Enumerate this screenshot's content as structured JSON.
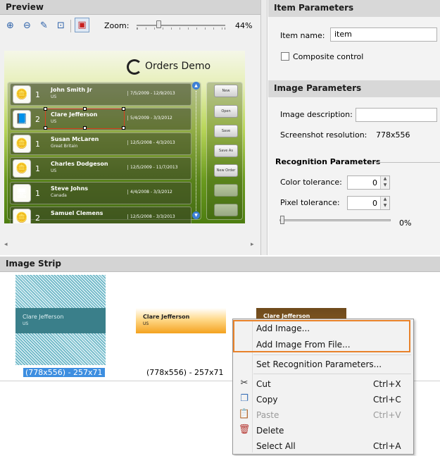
{
  "preview": {
    "title": "Preview",
    "zoom_label": "Zoom:",
    "zoom_value": "44%",
    "zoom_level": 0.44,
    "toolbar_icons": [
      "zoom-in-icon",
      "zoom-out-icon",
      "eyedropper-icon",
      "zoom-fit-icon",
      "select-region-icon"
    ]
  },
  "demo": {
    "title": "Orders Demo",
    "rows": [
      {
        "name": "John Smith Jr",
        "sub": "US",
        "count": "1",
        "dates": "7/5/2009 - 12/9/2013",
        "icon": "coins-icon"
      },
      {
        "name": "Clare Jefferson",
        "sub": "US",
        "count": "2",
        "dates": "5/4/2009 - 3/3/2012",
        "icon": "book-icon"
      },
      {
        "name": "Susan McLaren",
        "sub": "Great Britain",
        "count": "1",
        "dates": "12/5/2008 - 4/3/2013",
        "icon": "coins-icon"
      },
      {
        "name": "Charles Dodgeson",
        "sub": "US",
        "count": "1",
        "dates": "12/5/2009 - 11/7/2013",
        "icon": "coins-icon"
      },
      {
        "name": "Steve Johns",
        "sub": "Canada",
        "count": "1",
        "dates": "4/4/2008 - 3/3/2012",
        "icon": "computer-icon"
      },
      {
        "name": "Samuel Clemens",
        "sub": "",
        "count": "2",
        "dates": "12/5/2008 - 3/3/2013",
        "icon": "coins-icon"
      }
    ],
    "buttons": [
      "New",
      "Open",
      "Save",
      "Save As",
      "New Order",
      "",
      ""
    ]
  },
  "item_params": {
    "title": "Item Parameters",
    "name_label": "Item name:",
    "name_value": "item",
    "composite_label": "Composite control",
    "composite_checked": false
  },
  "image_params": {
    "title": "Image Parameters",
    "desc_label": "Image description:",
    "desc_value": "",
    "resolution_label": "Screenshot resolution:",
    "resolution_value": "778x556"
  },
  "recog_params": {
    "title": "Recognition Parameters",
    "color_label": "Color tolerance:",
    "color_value": "0",
    "pixel_label": "Pixel tolerance:",
    "pixel_value": "0",
    "slider_value": "0%"
  },
  "strip": {
    "title": "Image Strip",
    "items": [
      {
        "text": "Clare Jefferson",
        "sub": "US",
        "caption": "(778x556) - 257x71",
        "selected": true
      },
      {
        "text": "Clare Jefferson",
        "sub": "US",
        "caption": "(778x556) - 257x71",
        "selected": false
      },
      {
        "text": "Clare Jefferson",
        "sub": "",
        "caption": "",
        "selected": false
      }
    ]
  },
  "context_menu": {
    "items": [
      {
        "label": "Add Image...",
        "shortcut": "",
        "icon": "",
        "enabled": true
      },
      {
        "label": "Add Image From File...",
        "shortcut": "",
        "icon": "",
        "enabled": true
      },
      {
        "label": "Set Recognition Parameters...",
        "shortcut": "",
        "icon": "",
        "enabled": true
      },
      {
        "label": "Cut",
        "shortcut": "Ctrl+X",
        "icon": "scissors-icon",
        "enabled": true
      },
      {
        "label": "Copy",
        "shortcut": "Ctrl+C",
        "icon": "copy-icon",
        "enabled": true
      },
      {
        "label": "Paste",
        "shortcut": "Ctrl+V",
        "icon": "paste-icon",
        "enabled": false
      },
      {
        "label": "Delete",
        "shortcut": "",
        "icon": "trash-icon",
        "enabled": true
      },
      {
        "label": "Select All",
        "shortcut": "Ctrl+A",
        "icon": "",
        "enabled": true
      }
    ],
    "highlight_color": "#e8822a"
  }
}
